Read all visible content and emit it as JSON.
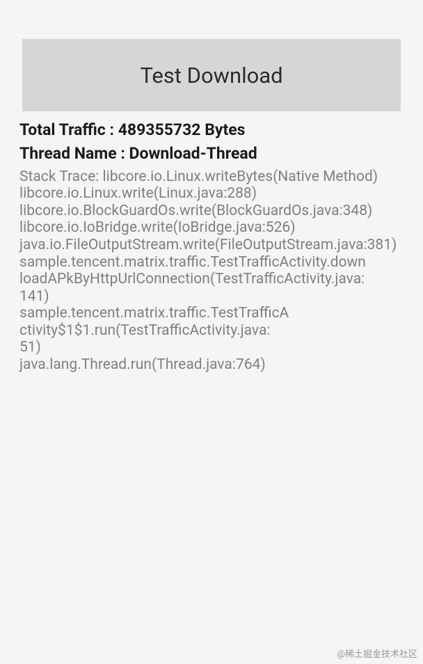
{
  "button": {
    "label": "Test Download"
  },
  "traffic": {
    "label": "Total Traffic : ",
    "value": "489355732",
    "unit": " Bytes"
  },
  "thread": {
    "label": "Thread Name : ",
    "value": "Download-Thread"
  },
  "stackTrace": {
    "content": "Stack Trace: libcore.io.Linux.writeBytes(Native Method)\nlibcore.io.Linux.write(Linux.java:288)\nlibcore.io.BlockGuardOs.write(BlockGuardOs.java:348)\nlibcore.io.IoBridge.write(IoBridge.java:526)\njava.io.FileOutputStream.write(FileOutputStream.java:381)\nsample.tencent.matrix.traffic.TestTrafficActivity.down\nloadAPkByHttpUrlConnection(TestTrafficActivity.java:\n141)\nsample.tencent.matrix.traffic.TestTrafficA\nctivity$1$1.run(TestTrafficActivity.java:\n51)\njava.lang.Thread.run(Thread.java:764)"
  },
  "watermark": "@稀土掘金技术社区"
}
